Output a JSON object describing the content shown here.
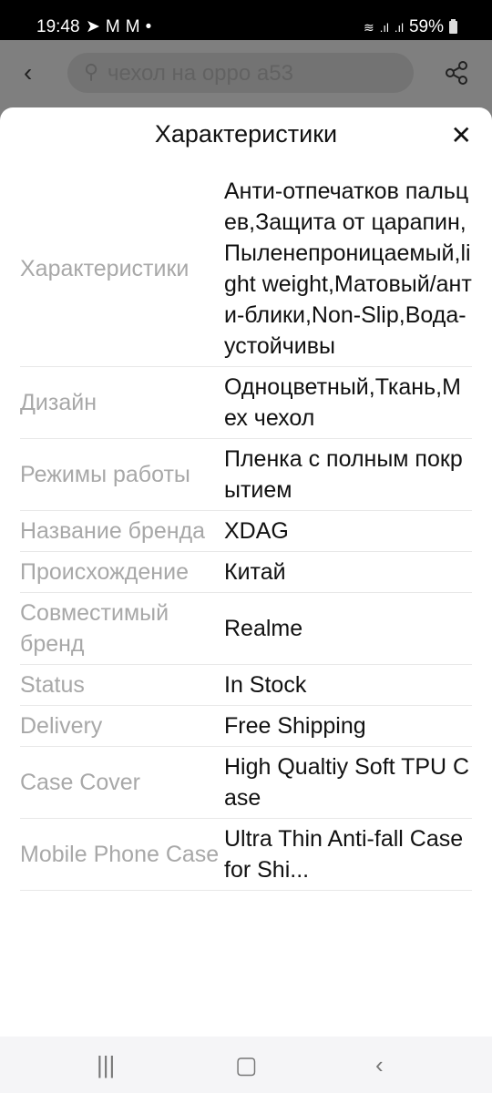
{
  "status_bar": {
    "time": "19:48",
    "notif_icons": [
      "telegram-icon",
      "gmail-icon",
      "gmail-icon",
      "dot-icon"
    ],
    "battery": "59%"
  },
  "top_bar": {
    "search_text": "чехол на oppo a53"
  },
  "sheet": {
    "title": "Характеристики",
    "rows": [
      {
        "key": "Характеристики",
        "value": "Анти-отпечатков пальцев,Защита от царапин,Пыленепроницаемый,light weight,Матовый/анти-блики,Non-Slip,Вода-устойчивы"
      },
      {
        "key": "Дизайн",
        "value": "Одноцветный,Ткань,Мех чехол"
      },
      {
        "key": "Режимы работы",
        "value": "Пленка с полным покрытием"
      },
      {
        "key": "Название бренда",
        "value": "XDAG"
      },
      {
        "key": "Происхождение",
        "value": "Китай"
      },
      {
        "key": "Совместимый бренд",
        "value": "Realme"
      },
      {
        "key": "Status",
        "value": "In Stock"
      },
      {
        "key": "Delivery",
        "value": "Free Shipping"
      },
      {
        "key": "Case Cover",
        "value": "High Qualtiy Soft TPU Case"
      },
      {
        "key": "Mobile Phone Case",
        "value": "Ultra Thin Anti-fall Case for Shi..."
      }
    ]
  }
}
